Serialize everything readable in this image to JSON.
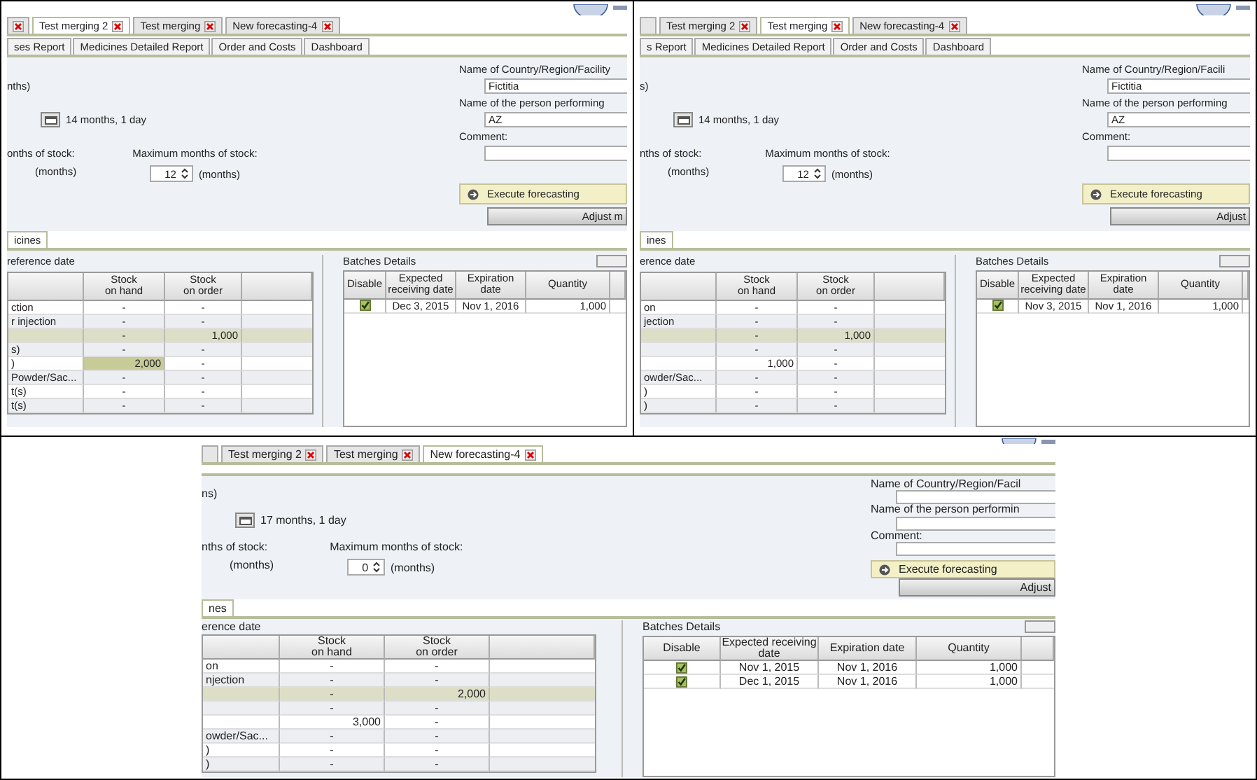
{
  "panels": [
    {
      "cut_tab_close": true,
      "doc_tabs": [
        {
          "label": "Test merging 2",
          "selected": true
        },
        {
          "label": "Test merging",
          "selected": false
        },
        {
          "label": "New forecasting-4",
          "selected": false
        }
      ],
      "report_tabs": [
        "ses Report",
        "Medicines Detailed Report",
        "Order and Costs",
        "Dashboard"
      ],
      "period_text": "nths)",
      "duration": "14 months, 1 day",
      "min_stock_label": "onths of stock:",
      "min_stock_unit": "(months)",
      "max_stock_label": "Maximum months of stock:",
      "max_stock_value": "12",
      "max_stock_unit": "(months)",
      "fields": [
        {
          "label": "Name of Country/Region/Facility",
          "value": "Fictitia"
        },
        {
          "label": "Name of the person performing",
          "value": "AZ"
        },
        {
          "label": "Comment:"
        }
      ],
      "execute_button": "Execute forecasting",
      "adjust_button": "Adjust m",
      "sub_tabs": [
        {
          "label": "icines",
          "selected": true
        }
      ],
      "stock_caption": "reference date",
      "stock_columns": [
        "Stock on hand",
        "Stock on order"
      ],
      "stock_rows": [
        {
          "name": "ction",
          "on_hand": "-",
          "on_order": "-",
          "selected": false,
          "on_hand_highlighted": false
        },
        {
          "name": "r injection",
          "on_hand": "-",
          "on_order": "-",
          "selected": false,
          "on_hand_highlighted": false
        },
        {
          "on_hand": "-",
          "on_order": "1,000",
          "selected": true,
          "on_hand_highlighted": false
        },
        {
          "name": "s)",
          "on_hand": "-",
          "on_order": "-",
          "selected": false,
          "on_hand_highlighted": false
        },
        {
          "name": ")",
          "on_hand": "2,000",
          "on_order": "-",
          "selected": false,
          "on_hand_highlighted": true
        },
        {
          "name": "Powder/Sac...",
          "on_hand": "-",
          "on_order": "-",
          "selected": false,
          "on_hand_highlighted": false
        },
        {
          "name": "t(s)",
          "on_hand": "-",
          "on_order": "-",
          "selected": false,
          "on_hand_highlighted": false
        },
        {
          "name": "t(s)",
          "on_hand": "-",
          "on_order": "-",
          "selected": false,
          "on_hand_highlighted": false
        }
      ],
      "batches_title": "Batches Details",
      "batch_columns": [
        "Disable",
        "Expected receiving date",
        "Expiration date",
        "Quantity"
      ],
      "batches": [
        {
          "checked": true,
          "received": "Dec 3, 2015",
          "expires": "Nov 1, 2016",
          "quantity": "1,000"
        }
      ]
    },
    {
      "cut_tab_close": false,
      "doc_tabs": [
        {
          "label": "Test merging 2",
          "selected": false
        },
        {
          "label": "Test merging",
          "selected": true
        },
        {
          "label": "New forecasting-4",
          "selected": false
        }
      ],
      "report_tabs": [
        "s Report",
        "Medicines Detailed Report",
        "Order and Costs",
        "Dashboard"
      ],
      "period_text": "s)",
      "duration": "14 months, 1 day",
      "min_stock_label": "nths of stock:",
      "min_stock_unit": "(months)",
      "max_stock_label": "Maximum months of stock:",
      "max_stock_value": "12",
      "max_stock_unit": "(months)",
      "fields": [
        {
          "label": "Name of Country/Region/Facili",
          "value": "Fictitia"
        },
        {
          "label": "Name of the person performing",
          "value": "AZ"
        },
        {
          "label": "Comment:"
        }
      ],
      "execute_button": "Execute forecasting",
      "adjust_button": "Adjust",
      "sub_tabs": [
        {
          "label": "ines",
          "selected": true
        }
      ],
      "stock_caption": "erence date",
      "stock_columns": [
        "Stock on hand",
        "Stock on order"
      ],
      "stock_rows": [
        {
          "name": "on",
          "on_hand": "-",
          "on_order": "-",
          "selected": false,
          "on_hand_highlighted": false
        },
        {
          "name": "jection",
          "on_hand": "-",
          "on_order": "-",
          "selected": false,
          "on_hand_highlighted": false
        },
        {
          "on_hand": "-",
          "on_order": "1,000",
          "selected": true,
          "on_hand_highlighted": false
        },
        {
          "on_hand": "-",
          "on_order": "-",
          "selected": false,
          "on_hand_highlighted": false
        },
        {
          "on_hand": "1,000",
          "on_order": "-",
          "selected": false,
          "on_hand_highlighted": false
        },
        {
          "name": "owder/Sac...",
          "on_hand": "-",
          "on_order": "-",
          "selected": false,
          "on_hand_highlighted": false
        },
        {
          "name": ")",
          "on_hand": "-",
          "on_order": "-",
          "selected": false,
          "on_hand_highlighted": false
        },
        {
          "name": ")",
          "on_hand": "-",
          "on_order": "-",
          "selected": false,
          "on_hand_highlighted": false
        }
      ],
      "batches_title": "Batches Details",
      "batch_columns": [
        "Disable",
        "Expected receiving date",
        "Expiration date",
        "Quantity"
      ],
      "batches": [
        {
          "checked": true,
          "received": "Nov 3, 2015",
          "expires": "Nov 1, 2016",
          "quantity": "1,000"
        }
      ]
    },
    {
      "cut_tab_close": false,
      "doc_tabs": [
        {
          "label": "Test merging 2",
          "selected": false
        },
        {
          "label": "Test merging",
          "selected": false
        },
        {
          "label": "New forecasting-4",
          "selected": true
        }
      ],
      "period_text": "ns)",
      "duration": "17 months, 1 day",
      "min_stock_label": "nths of stock:",
      "min_stock_unit": "(months)",
      "max_stock_label": "Maximum months of stock:",
      "max_stock_value": "0",
      "max_stock_unit": "(months)",
      "fields": [
        {
          "label": "Name of Country/Region/Facil"
        },
        {
          "label": "Name of the person performin"
        },
        {
          "label": "Comment:"
        }
      ],
      "execute_button": "Execute forecasting",
      "adjust_button": "Adjust",
      "sub_tabs": [
        {
          "label": "nes",
          "selected": true
        }
      ],
      "stock_caption": "erence date",
      "stock_columns": [
        "Stock on hand",
        "Stock on order"
      ],
      "stock_rows": [
        {
          "name": "on",
          "on_hand": "-",
          "on_order": "-",
          "selected": false,
          "on_hand_highlighted": false
        },
        {
          "name": "njection",
          "on_hand": "-",
          "on_order": "-",
          "selected": false,
          "on_hand_highlighted": false
        },
        {
          "on_hand": "-",
          "on_order": "2,000",
          "selected": true,
          "on_hand_highlighted": false
        },
        {
          "on_hand": "-",
          "on_order": "-",
          "selected": false,
          "on_hand_highlighted": false
        },
        {
          "on_hand": "3,000",
          "on_order": "-",
          "selected": false,
          "on_hand_highlighted": false
        },
        {
          "name": "owder/Sac...",
          "on_hand": "-",
          "on_order": "-",
          "selected": false,
          "on_hand_highlighted": false
        },
        {
          "name": ")",
          "on_hand": "-",
          "on_order": "-",
          "selected": false,
          "on_hand_highlighted": false
        },
        {
          "name": ")",
          "on_hand": "-",
          "on_order": "-",
          "selected": false,
          "on_hand_highlighted": false
        }
      ],
      "batches_title": "Batches Details",
      "batch_columns": [
        "Disable",
        "Expected receiving date",
        "Expiration date",
        "Quantity"
      ],
      "batches": [
        {
          "checked": true,
          "received": "Nov 1, 2015",
          "expires": "Nov 1, 2016",
          "quantity": "1,000"
        },
        {
          "checked": true,
          "received": "Dec 1, 2015",
          "expires": "Nov 1, 2016",
          "quantity": "1,000"
        }
      ]
    }
  ]
}
